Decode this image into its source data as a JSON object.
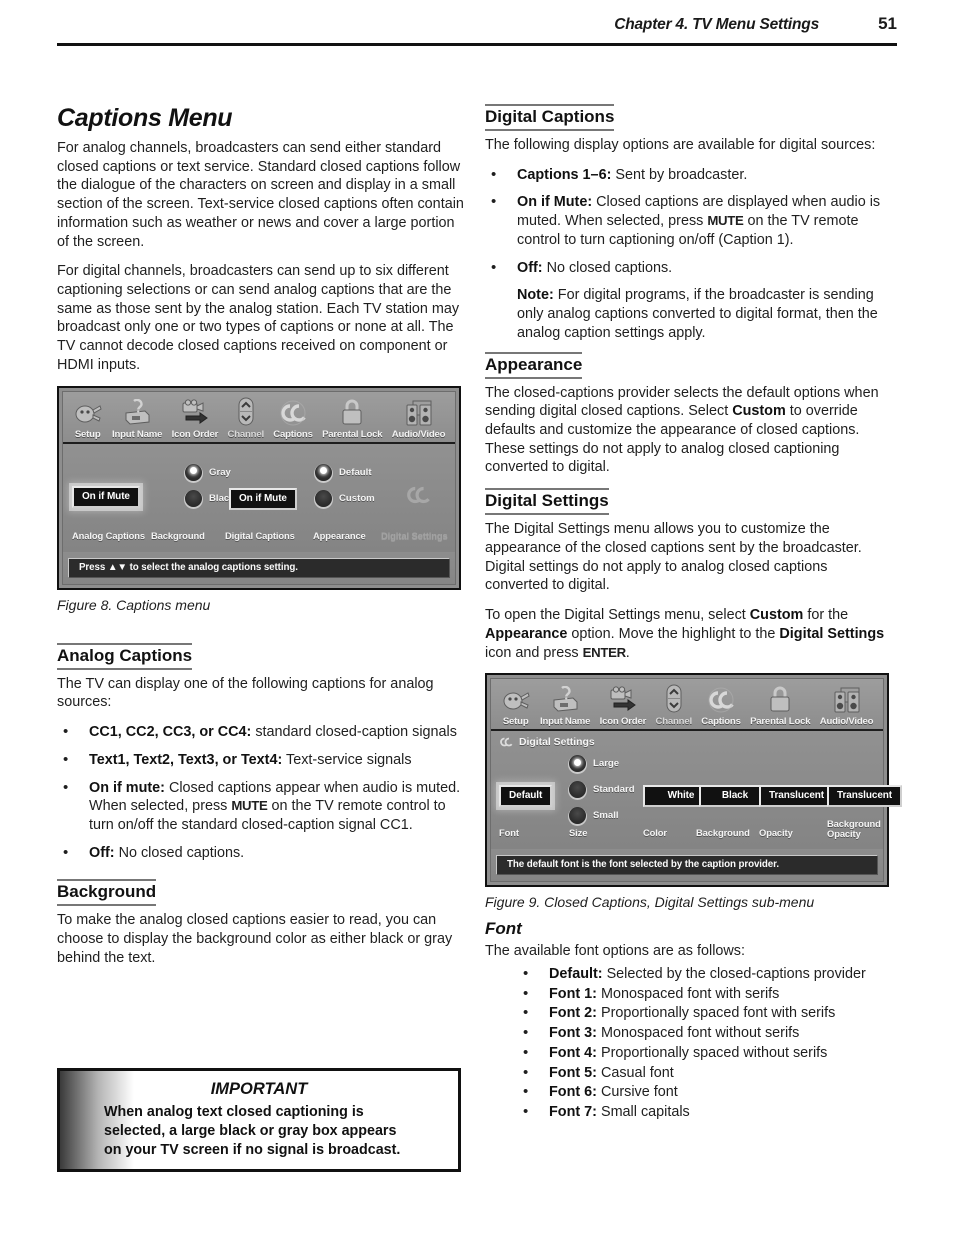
{
  "header": {
    "chapter": "Chapter 4. TV Menu Settings",
    "page_number": "51"
  },
  "left_column": {
    "title": "Captions Menu",
    "intro_p1": "For analog channels, broadcasters can send either standard closed captions or text service.  Standard closed captions follow the dialogue of the characters on screen and display in a small section of the screen.  Text-service closed captions often contain information such as weather or news and cover a large portion of the screen.",
    "intro_p2": "For digital channels, broadcasters can send up to six different captioning selections or can send analog captions that are the same as those sent by the analog station.  Each TV station may broadcast only one or two types of captions or none at all.  The TV cannot decode closed captions received on component or HDMI inputs.",
    "figure8_caption": "Figure 8. Captions menu",
    "analog_captions": {
      "heading": "Analog Captions",
      "intro": "The TV can display one of the following captions for analog sources:",
      "items": [
        {
          "label": "CC1, CC2, CC3, or CC4:",
          "text": " standard closed-caption signals"
        },
        {
          "label": "Text1, Text2, Text3, or Text4:",
          "text": " Text-service signals"
        },
        {
          "label": "On if mute:",
          "text": " Closed captions appear when audio is muted.  When selected, press ",
          "mono": "MUTE",
          "text2": " on the TV remote control to turn on/off the standard closed-caption signal CC1."
        },
        {
          "label": "Off:",
          "text": " No closed captions."
        }
      ]
    },
    "background": {
      "heading": "Background",
      "text": "To make the analog closed captions easier to read, you can choose to display the background color as either black or gray behind the text."
    }
  },
  "important_box": {
    "title": "IMPORTANT",
    "line1": "When analog text closed captioning is",
    "line2": "selected, a large black or gray box appears",
    "line3": "on your TV screen if no signal is broadcast."
  },
  "right_column": {
    "digital_captions": {
      "heading": "Digital Captions",
      "intro": "The following display options are available for digital sources:",
      "items": [
        {
          "label": "Captions 1–6:",
          "text": " Sent by broadcaster."
        },
        {
          "label": "On if Mute:",
          "text": " Closed captions are displayed when audio is muted.  When selected, press ",
          "mono": "MUTE",
          "text2": " on the TV remote control to turn captioning on/off (Caption 1)."
        },
        {
          "label": "Off:",
          "text": " No closed captions."
        },
        {
          "label": "Note:",
          "text": " For digital programs, if the broadcaster is sending only analog captions converted to digital format, then the analog caption settings apply.",
          "nobullet": true
        }
      ]
    },
    "appearance": {
      "heading": "Appearance",
      "text_a": "The closed-captions provider selects the default options when sending digital closed captions.  Select ",
      "bold_a": "Custom",
      "text_b": " to override defaults and customize the appearance of closed captions.  These settings do not apply to analog closed captioning converted to digital."
    },
    "digital_settings": {
      "heading": "Digital Settings",
      "p1": "The Digital Settings menu allows you to customize the appearance of the closed captions sent by the broadcaster.  Digital settings do not apply to analog closed captions converted to digital.",
      "p2_a": "To open the Digital Settings menu, select ",
      "p2_bold1": "Custom",
      "p2_b": " for the ",
      "p2_bold2": "Appearance",
      "p2_c": " option.  Move the highlight to the ",
      "p2_bold3": "Digital Settings",
      "p2_d": " icon and press ",
      "p2_mono": "ENTER",
      "p2_e": "."
    },
    "figure9_caption": "Figure 9. Closed Captions, Digital Settings sub-menu",
    "font": {
      "heading": "Font",
      "intro": "The available font options are as follows:",
      "items": [
        {
          "label": "Default:",
          "text": " Selected by the closed-captions provider"
        },
        {
          "label": "Font 1:",
          "text": " Monospaced font with serifs"
        },
        {
          "label": "Font 2:",
          "text": " Proportionally spaced font with serifs"
        },
        {
          "label": "Font 3:",
          "text": " Monospaced font without serifs"
        },
        {
          "label": "Font 4:",
          "text": " Proportionally spaced without serifs"
        },
        {
          "label": "Font 5:",
          "text": " Casual font"
        },
        {
          "label": "Font 6:",
          "text": " Cursive font"
        },
        {
          "label": "Font 7:",
          "text": " Small capitals"
        }
      ]
    }
  },
  "figure8": {
    "iconbar": [
      {
        "label": "Setup",
        "icon": "plug-icon"
      },
      {
        "label": "Input Name",
        "icon": "input-label-icon"
      },
      {
        "label": "Icon Order",
        "icon": "camera-arrow-icon"
      },
      {
        "label": "Channel",
        "icon": "channel-updown-icon"
      },
      {
        "label": "Captions",
        "icon": "captions-cc-icon"
      },
      {
        "label": "Parental Lock",
        "icon": "padlock-icon"
      },
      {
        "label": "Audio/Video",
        "icon": "speakers-icon"
      }
    ],
    "columns": [
      {
        "label": "Analog Captions",
        "value": "On if Mute",
        "highlighted": true
      },
      {
        "label": "Background",
        "radios": [
          {
            "label": "Gray",
            "selected": true
          },
          {
            "label": "Black",
            "selected": false
          }
        ]
      },
      {
        "label": "Digital Captions",
        "value": "On if Mute",
        "highlighted": false
      },
      {
        "label": "Appearance",
        "radios": [
          {
            "label": "Default",
            "selected": true
          },
          {
            "label": "Custom",
            "selected": false
          }
        ]
      },
      {
        "label": "Digital Settings",
        "greyed": true,
        "icon": "captions-cc-icon"
      }
    ],
    "status": "Press ▲▼ to select the analog captions setting."
  },
  "figure9": {
    "iconbar": [
      {
        "label": "Setup",
        "icon": "plug-icon"
      },
      {
        "label": "Input Name",
        "icon": "input-label-icon"
      },
      {
        "label": "Icon Order",
        "icon": "camera-arrow-icon"
      },
      {
        "label": "Channel",
        "icon": "channel-updown-icon"
      },
      {
        "label": "Captions",
        "icon": "captions-cc-icon"
      },
      {
        "label": "Parental Lock",
        "icon": "padlock-icon"
      },
      {
        "label": "Audio/Video",
        "icon": "speakers-icon"
      }
    ],
    "submenu_title": "Digital Settings",
    "columns": [
      {
        "label": "Font",
        "value": "Default",
        "highlighted": true
      },
      {
        "label": "Size",
        "radios": [
          {
            "label": "Large",
            "selected": true
          },
          {
            "label": "Standard",
            "selected": false
          },
          {
            "label": "Small",
            "selected": false
          }
        ]
      },
      {
        "label": "Color",
        "value": "White",
        "highlighted": false
      },
      {
        "label": "Background",
        "value": "Black",
        "highlighted": false
      },
      {
        "label": "Opacity",
        "value": "Translucent",
        "highlighted": false
      },
      {
        "label": "Background Opacity",
        "value": "Translucent",
        "highlighted": false
      }
    ],
    "status": "The default font is the font selected by the caption provider."
  },
  "colors": {
    "menu_bg": "#8e8e8e",
    "menu_border": "#111111",
    "value_btn_bg": "#111111",
    "status_bg": "#2b2b2b",
    "rule": "#777777"
  }
}
